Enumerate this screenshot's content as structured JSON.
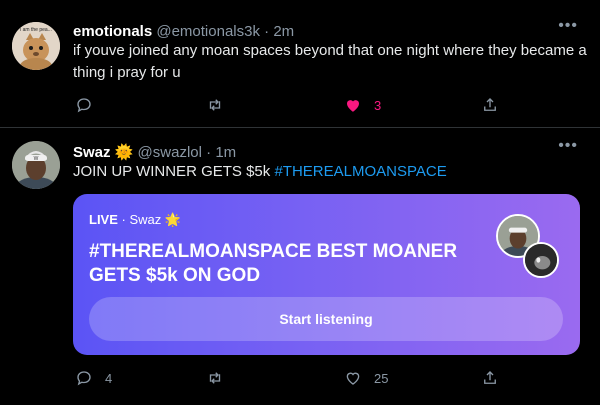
{
  "tweets": [
    {
      "name": "emotionals",
      "handle": "@emotionals3k",
      "time": "2m",
      "text": "if youve joined any moan spaces beyond that one night where they became a thing i pray for u",
      "avatar_text": "i am the pea...",
      "likes": "3",
      "liked": true
    },
    {
      "name": "Swaz",
      "name_emoji": "🌞",
      "handle": "@swazlol",
      "time": "1m",
      "text": "JOIN UP WINNER GETS $5k",
      "hashtag": "#THEREALMOANSPACE",
      "replies": "4",
      "likes": "25",
      "space": {
        "live_label": "LIVE",
        "host": "Swaz",
        "host_emoji": "🌟",
        "title": "#THEREALMOANSPACE BEST MOANER GETS $5k ON GOD",
        "button_label": "Start listening"
      }
    }
  ],
  "colors": {
    "background": "#000000",
    "like_active": "#f91880",
    "link": "#1d9bf0",
    "muted": "#8b98a5",
    "space_gradient_start": "#5b54f5",
    "space_gradient_end": "#9a6af0"
  },
  "icons": [
    "reply-icon",
    "retweet-icon",
    "heart-icon",
    "share-icon",
    "more-icon",
    "sun-icon",
    "star-icon"
  ]
}
